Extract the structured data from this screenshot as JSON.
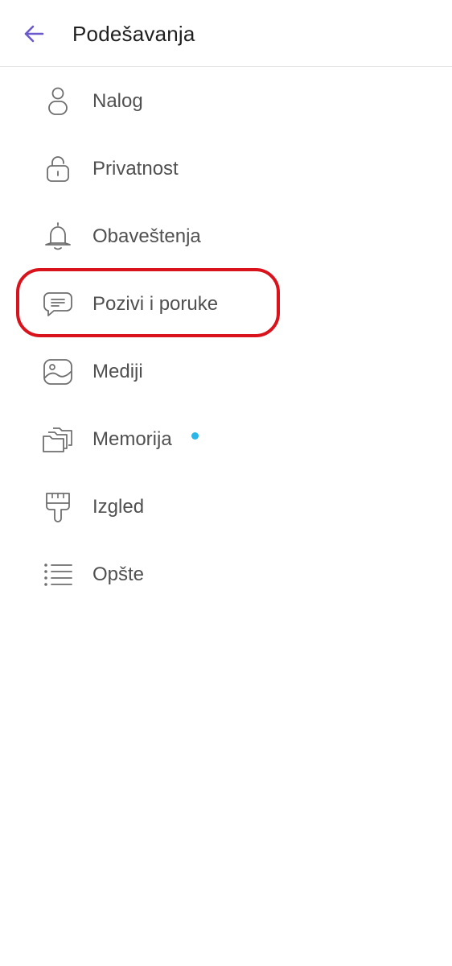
{
  "header": {
    "back_icon": "arrow-left-icon",
    "title": "Podešavanja"
  },
  "colors": {
    "accent": "#6a5acd",
    "icon_stroke": "#6e6e6e",
    "label": "#505050",
    "highlight": "#d9121b",
    "notification_dot": "#29b6e8"
  },
  "menu": {
    "items": [
      {
        "label": "Nalog",
        "icon": "person-icon"
      },
      {
        "label": "Privatnost",
        "icon": "lock-icon"
      },
      {
        "label": "Obaveštenja",
        "icon": "bell-icon"
      },
      {
        "label": "Pozivi i poruke",
        "icon": "chat-bubble-icon",
        "highlighted": true
      },
      {
        "label": "Mediji",
        "icon": "image-icon"
      },
      {
        "label": "Memorija",
        "icon": "folders-icon",
        "has_notification_dot": true
      },
      {
        "label": "Izgled",
        "icon": "paint-brush-icon"
      },
      {
        "label": "Opšte",
        "icon": "list-icon"
      }
    ]
  }
}
